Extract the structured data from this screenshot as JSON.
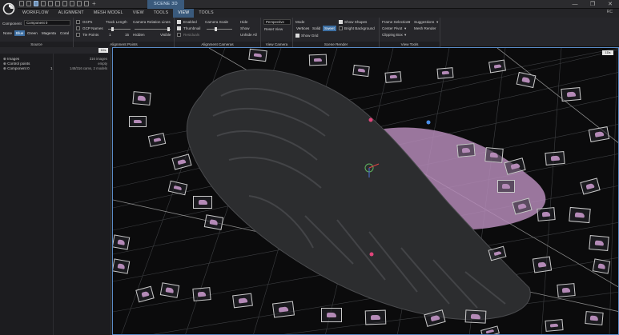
{
  "titlebar": {
    "scene_tab": "SCENE 3D",
    "window_controls": [
      "—",
      "❐",
      "✕"
    ]
  },
  "menubar": {
    "items": [
      "WORKFLOW",
      "ALIGNMENT",
      "MESH MODEL",
      "VIEW",
      "TOOLS",
      "VIEW",
      "TOOLS"
    ],
    "right_text": "RC"
  },
  "ribbon": {
    "source": {
      "component_label": "Component",
      "component_value": "Component 0",
      "colors": [
        "None",
        "Blue",
        "Green",
        "Magenta",
        "Coral"
      ],
      "selected_color": "Blue",
      "label": "Source"
    },
    "alignment_points": {
      "gcps": "GCPs",
      "gcp_names": "GCP Names",
      "tie_points": "Tie Points",
      "track_length": "Track Length",
      "track_min": "1",
      "track_max": "15",
      "camera_relation_lines": "Camera Relation Lines",
      "hidden": "Hidden",
      "visible": "Visible",
      "label": "Alignment Points"
    },
    "alignment_cameras": {
      "enabled": "Enabled",
      "thumbnail": "Thumbnail",
      "residuals": "Residuals",
      "hide": "Hide",
      "show": "Show",
      "unhide_all": "Unhide All",
      "label": "Alignment Cameras"
    },
    "view_camera": {
      "projection": "Perspective",
      "reset_view": "Reset View",
      "label": "View Camera"
    },
    "scene_render": {
      "mode": "Mode",
      "modes": [
        "Vertices",
        "Solid",
        "Sweet"
      ],
      "selected_mode": "Sweet",
      "show_shapes": "Show Shapes",
      "bright_background": "Bright Background",
      "show_grid": "Show Grid",
      "label": "Scene Render"
    },
    "view_tools": {
      "frame_selection": "Frame Selection",
      "suggestions": "Suggestions",
      "center_pivot": "Center Pivot",
      "mesh_render": "Mesh Render",
      "clipping_box": "Clipping Box",
      "label": "View Tools"
    }
  },
  "left_panel": {
    "badge": "1Ds",
    "rows": [
      {
        "name": "Images",
        "value": "316 images"
      },
      {
        "name": "Control points",
        "value": "empty"
      },
      {
        "name": "Component 0",
        "value": "1",
        "detail": "148/316 cams, 2 models"
      }
    ]
  },
  "viewport": {
    "badge": "1Ds",
    "accent": "#5a8cc8",
    "mesh_color": "#b48ab7"
  }
}
